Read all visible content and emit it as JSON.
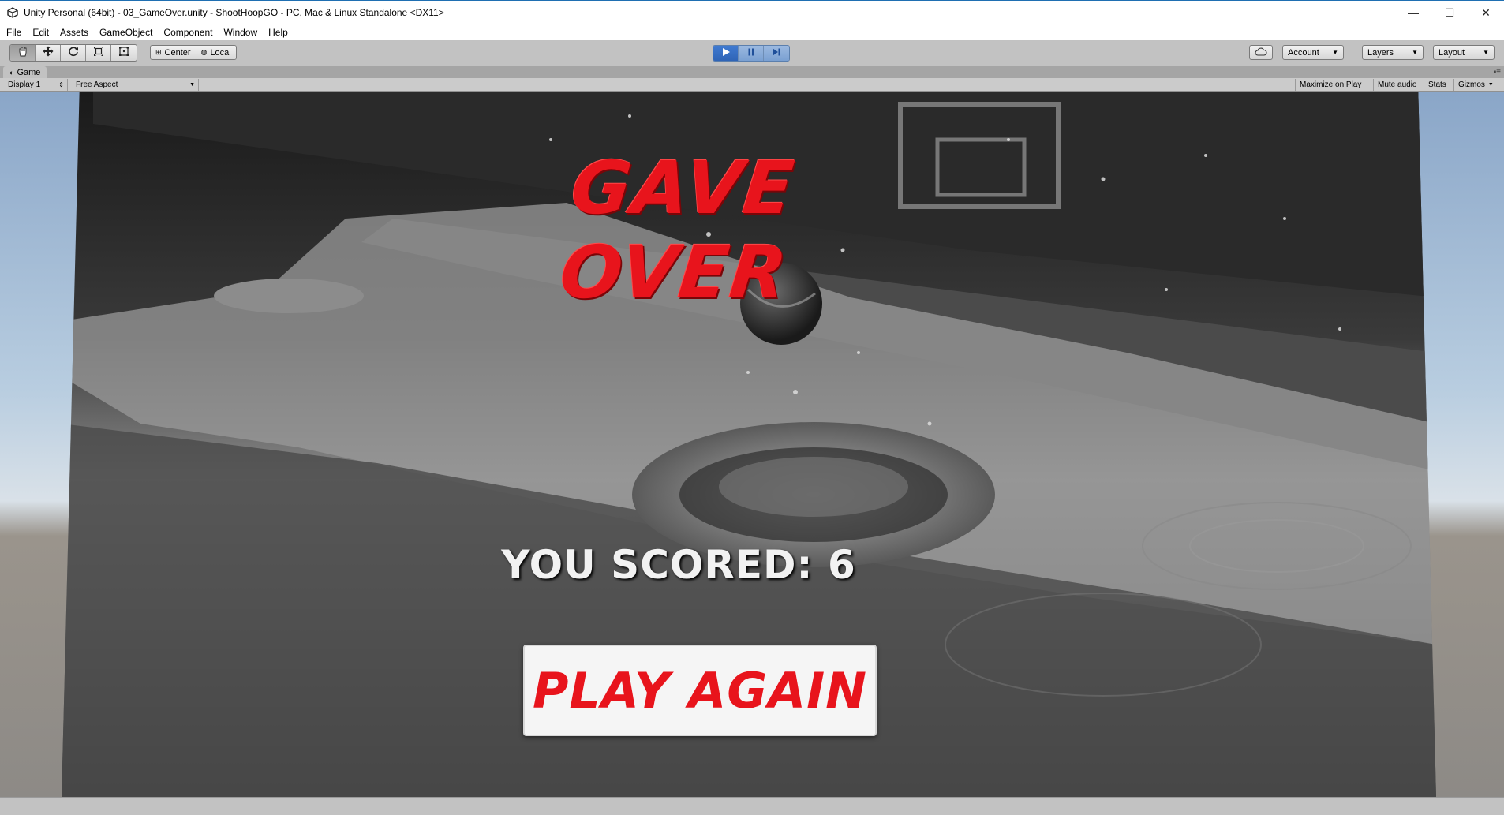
{
  "window": {
    "title": "Unity Personal (64bit) - 03_GameOver.unity - ShootHoopGO - PC, Mac & Linux Standalone <DX11>",
    "controls": {
      "minimize": "—",
      "maximize": "☐",
      "close": "✕"
    }
  },
  "menu": [
    "File",
    "Edit",
    "Assets",
    "GameObject",
    "Component",
    "Window",
    "Help"
  ],
  "toolbar": {
    "tools": [
      "hand-tool",
      "move-tool",
      "rotate-tool",
      "scale-tool",
      "rect-tool"
    ],
    "pivot_center": "Center",
    "pivot_local": "Local",
    "account": "Account",
    "layers": "Layers",
    "layout": "Layout"
  },
  "game_panel": {
    "tab": "Game",
    "display": "Display 1",
    "aspect": "Free Aspect",
    "maximize_on_play": "Maximize on Play",
    "mute_audio": "Mute audio",
    "stats": "Stats",
    "gizmos": "Gizmos"
  },
  "game": {
    "title": "GAVE OVER",
    "score_text": "YOU SCORED: 6",
    "play_again": "PLAY AGAIN",
    "colors": {
      "accent": "#e8141c",
      "score": "#f2f2f2",
      "button_bg": "#f5f5f5"
    }
  }
}
